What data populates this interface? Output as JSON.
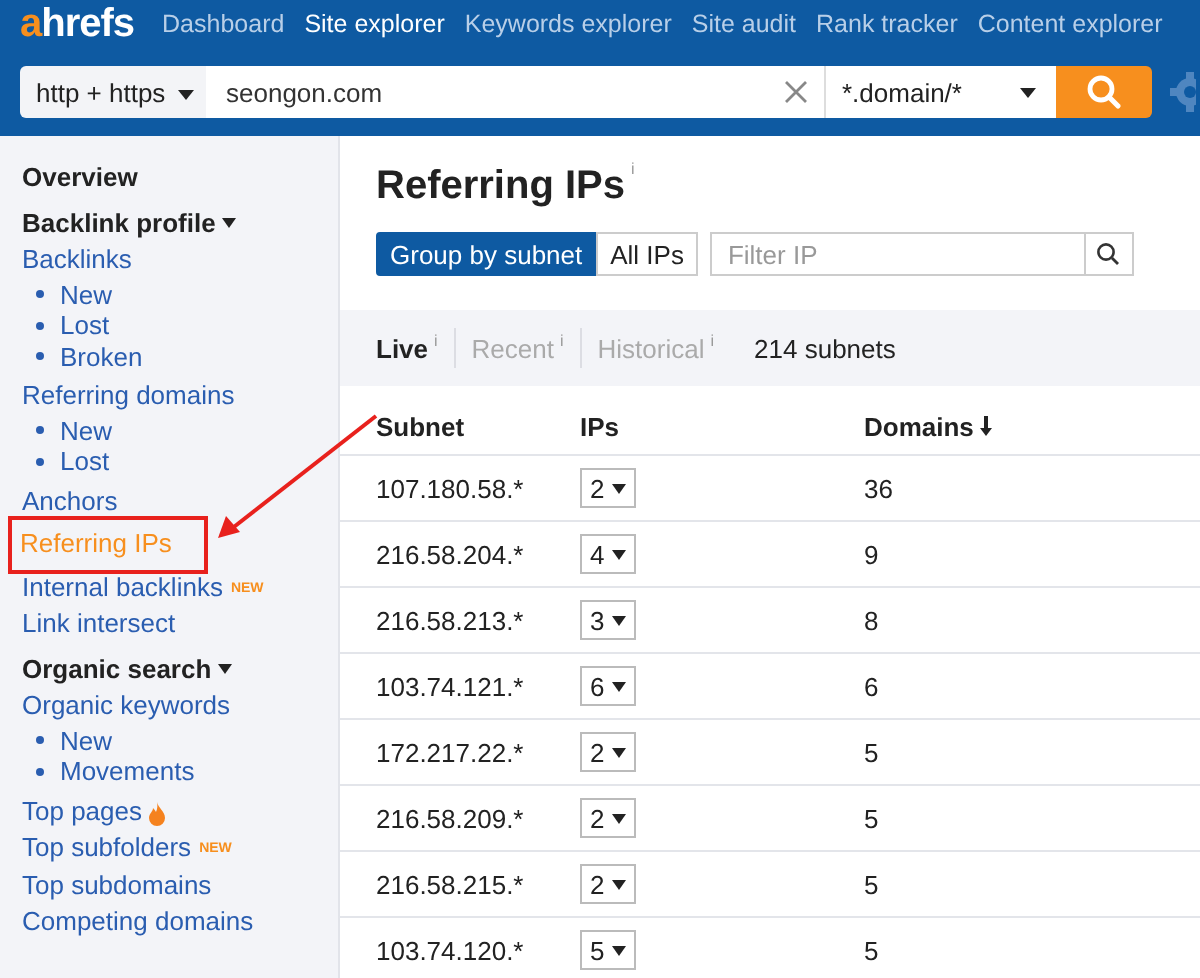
{
  "logo": "ahrefs",
  "nav": [
    {
      "label": "Dashboard",
      "selected": false
    },
    {
      "label": "Site explorer",
      "selected": true
    },
    {
      "label": "Keywords explorer",
      "selected": false
    },
    {
      "label": "Site audit",
      "selected": false
    },
    {
      "label": "Rank tracker",
      "selected": false
    },
    {
      "label": "Content explorer",
      "selected": false
    }
  ],
  "search": {
    "protocol": "http + https",
    "value": "seongon.com",
    "mode": "*.domain/*"
  },
  "sidebar": {
    "items": [
      {
        "kind": "heading",
        "label": "Overview",
        "selected": false
      },
      {
        "kind": "heading",
        "label": "Backlink profile",
        "caret": true,
        "selected": false
      },
      {
        "kind": "link",
        "label": "Backlinks",
        "selected": false
      },
      {
        "kind": "sub",
        "label": "New",
        "selected": false
      },
      {
        "kind": "sub",
        "label": "Lost",
        "selected": false
      },
      {
        "kind": "sub",
        "label": "Broken",
        "selected": false
      },
      {
        "kind": "link",
        "label": "Referring domains",
        "selected": false
      },
      {
        "kind": "sub",
        "label": "New",
        "selected": false
      },
      {
        "kind": "sub",
        "label": "Lost",
        "selected": false
      },
      {
        "kind": "link",
        "label": "Anchors",
        "selected": false
      },
      {
        "kind": "link",
        "label": "Referring IPs",
        "selected": true,
        "annotated": true
      },
      {
        "kind": "link",
        "label": "Internal backlinks",
        "badge": "NEW",
        "selected": false
      },
      {
        "kind": "link",
        "label": "Link intersect",
        "selected": false
      },
      {
        "kind": "heading",
        "label": "Organic search",
        "caret": true,
        "selected": false
      },
      {
        "kind": "link",
        "label": "Organic keywords",
        "selected": false
      },
      {
        "kind": "sub",
        "label": "New",
        "selected": false
      },
      {
        "kind": "sub",
        "label": "Movements",
        "selected": false
      },
      {
        "kind": "link",
        "label": "Top pages",
        "hot": true,
        "selected": false
      },
      {
        "kind": "link",
        "label": "Top subfolders",
        "badge": "NEW",
        "selected": false
      },
      {
        "kind": "link",
        "label": "Top subdomains",
        "selected": false
      },
      {
        "kind": "link",
        "label": "Competing domains",
        "selected": false
      }
    ]
  },
  "page": {
    "title": "Referring IPs",
    "title_info": "i",
    "group": [
      {
        "label": "Group by subnet",
        "selected": true
      },
      {
        "label": "All IPs",
        "selected": false
      }
    ],
    "filter": {
      "placeholder": "Filter IP"
    },
    "modes": [
      {
        "label": "Live",
        "info": "i",
        "selected": true
      },
      {
        "label": "Recent",
        "info": "i",
        "selected": false
      },
      {
        "label": "Historical",
        "info": "i",
        "selected": false
      }
    ],
    "count": "214 subnets"
  },
  "table": {
    "columns": [
      {
        "label": "Subnet"
      },
      {
        "label": "IPs"
      },
      {
        "label": "Domains",
        "sorted": true
      }
    ],
    "rows": [
      {
        "subnet": "107.180.58.*",
        "ips": "2",
        "domains": "36"
      },
      {
        "subnet": "216.58.204.*",
        "ips": "4",
        "domains": "9"
      },
      {
        "subnet": "216.58.213.*",
        "ips": "3",
        "domains": "8"
      },
      {
        "subnet": "103.74.121.*",
        "ips": "6",
        "domains": "6"
      },
      {
        "subnet": "172.217.22.*",
        "ips": "2",
        "domains": "5"
      },
      {
        "subnet": "216.58.209.*",
        "ips": "2",
        "domains": "5"
      },
      {
        "subnet": "216.58.215.*",
        "ips": "2",
        "domains": "5"
      },
      {
        "subnet": "103.74.120.*",
        "ips": "5",
        "domains": "5"
      }
    ]
  }
}
